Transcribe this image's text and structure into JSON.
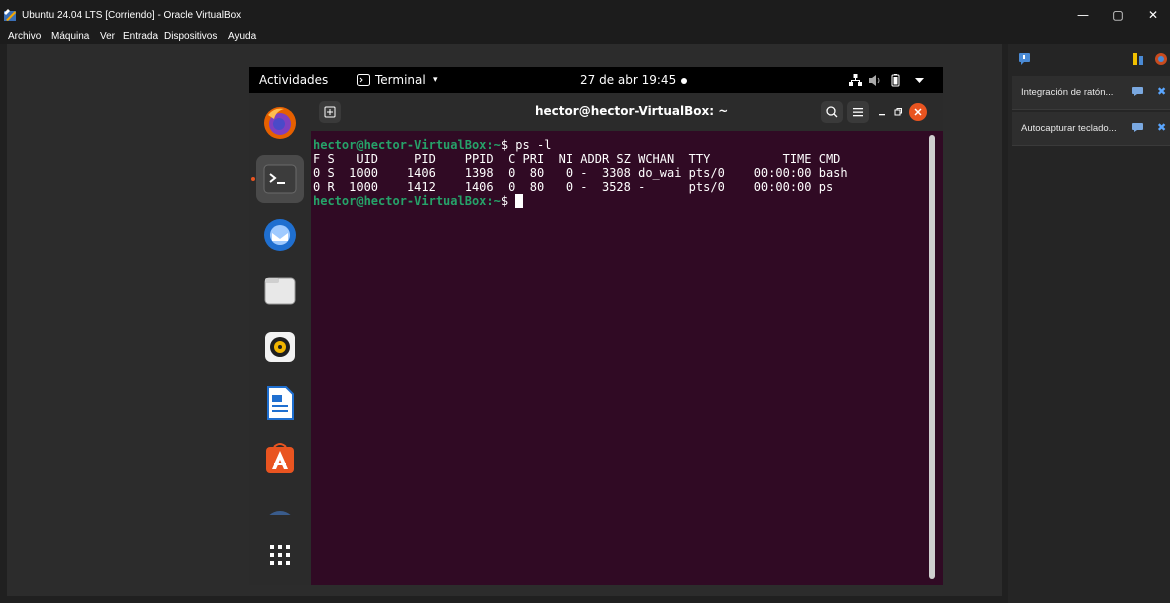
{
  "host_window": {
    "title": "Ubuntu 24.04 LTS [Corriendo] - Oracle VirtualBox",
    "icon": "virtualbox-icon",
    "controls": {
      "minimize": "—",
      "maximize": "▢",
      "close": "✕"
    }
  },
  "host_menu": {
    "items": [
      "Archivo",
      "Máquina",
      "Ver",
      "Entrada",
      "Dispositivos",
      "Ayuda"
    ]
  },
  "side_panel": {
    "toolbar_icons": [
      "notification-icon",
      "sort-icon",
      "logo-icon"
    ],
    "notifications": [
      {
        "text": "Integración de ratón...",
        "info_icon": "info-icon",
        "close_icon": "close-icon",
        "close_glyph": "✖"
      },
      {
        "text": "Autocapturar teclado...",
        "info_icon": "info-icon",
        "close_icon": "close-icon",
        "close_glyph": "✖"
      }
    ]
  },
  "guest": {
    "topbar": {
      "activities": "Actividades",
      "app_name": "Terminal",
      "caret": "▾",
      "clock": "27 de abr  19:45",
      "tray_icons": [
        "network-icon",
        "volume-icon",
        "battery-icon",
        "chevron-down-icon"
      ]
    },
    "dock": {
      "apps": [
        "firefox-icon",
        "terminal-icon",
        "thunderbird-icon",
        "files-icon",
        "rhythmbox-icon",
        "writer-icon",
        "app-center-icon",
        "disc-icon",
        "show-apps-icon"
      ]
    },
    "terminal": {
      "title": "hector@hector-VirtualBox: ~",
      "prompt_user": "hector@hector-VirtualBox",
      "prompt_path": ":~",
      "prompt_symbol": "$ ",
      "command": "ps -l",
      "output_lines": [
        "F S   UID     PID    PPID  C PRI  NI ADDR SZ WCHAN  TTY          TIME CMD",
        "0 S  1000    1406    1398  0  80   0 -  3308 do_wai pts/0    00:00:00 bash",
        "0 R  1000    1412    1406  0  80   0 -  3528 -      pts/0    00:00:00 ps"
      ]
    }
  },
  "colors": {
    "terminal_bg": "#300a24",
    "prompt_green": "#26a269",
    "ubuntu_orange": "#e95420",
    "accent_blue": "#5aa6ff"
  }
}
